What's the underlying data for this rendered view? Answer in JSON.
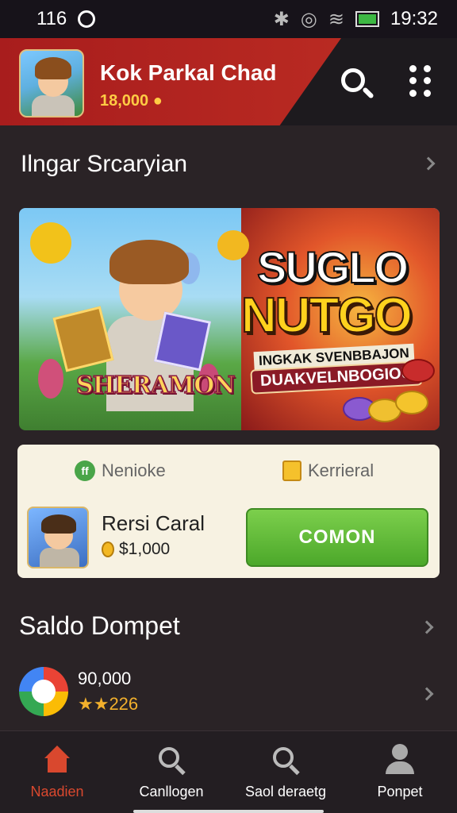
{
  "status_bar": {
    "left_number": "116",
    "time": "19:32"
  },
  "header": {
    "user_name": "Kok Parkal Chad",
    "coins": "18,000"
  },
  "section1": {
    "title": "Ilngar Srcaryian"
  },
  "banner": {
    "game_logo": "SHERAMON",
    "title_line1": "SUGLO",
    "title_line2": "NUTGO",
    "subtitle": "INGKAK SVENBBAJON",
    "tag": "DUAKVELNBOGIOU"
  },
  "offer": {
    "tab1": "Nenioke",
    "tab2": "Kerrieral",
    "item_name": "Rersi Caral",
    "item_price": "$1,000",
    "button_label": "COMON"
  },
  "wallet": {
    "title": "Saldo Dompet",
    "amount": "90,000",
    "rating": "★★226"
  },
  "bottom_nav": [
    {
      "label": "Naadien"
    },
    {
      "label": "Canllogen"
    },
    {
      "label": "Saol deraetg"
    },
    {
      "label": "Ponpet"
    }
  ],
  "colors": {
    "accent_red": "#b92a22",
    "button_green": "#4ca82a",
    "nav_active": "#d9482e"
  }
}
